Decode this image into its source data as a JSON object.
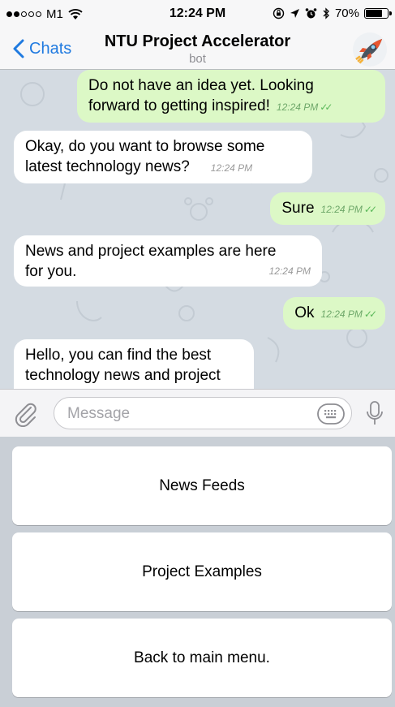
{
  "status_bar": {
    "carrier": "M1",
    "time": "12:24 PM",
    "battery": "70%",
    "battery_level": 0.7
  },
  "nav": {
    "back_label": "Chats",
    "title": "NTU Project Accelerator",
    "subtitle": "bot",
    "avatar_icon": "rocket-icon"
  },
  "messages": [
    {
      "dir": "out",
      "lines": [
        "Do not have an idea yet. Looking",
        "forward to getting inspired!"
      ],
      "time": "12:24 PM"
    },
    {
      "dir": "in",
      "lines": [
        "Okay, do you want to browse some",
        "latest technology news?"
      ],
      "time": "12:24 PM"
    },
    {
      "dir": "out",
      "lines": [
        "Sure"
      ],
      "time": "12:24 PM"
    },
    {
      "dir": "in",
      "lines": [
        "News and project examples are here",
        "for you."
      ],
      "time": "12:24 PM"
    },
    {
      "dir": "out",
      "lines": [
        "Ok"
      ],
      "time": "12:24 PM"
    },
    {
      "dir": "in",
      "lines": [
        "Hello, you can find the best",
        "technology news and project"
      ],
      "time": ""
    }
  ],
  "input": {
    "placeholder": "Message"
  },
  "keyboard_buttons": [
    "News Feeds",
    "Project Examples",
    "Back to main menu."
  ],
  "colors": {
    "accent": "#1f7ae0",
    "outgoing_bubble": "#dcf8c6",
    "incoming_bubble": "#ffffff",
    "chat_background": "#d4dbe2"
  }
}
